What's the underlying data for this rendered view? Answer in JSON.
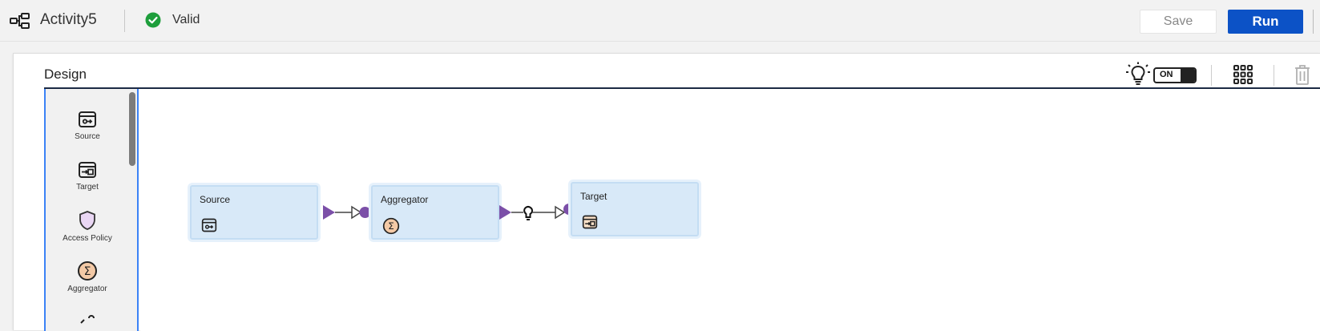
{
  "header": {
    "app_icon": "mapping-flow-icon",
    "title": "Activity5",
    "status_icon": "check-circle-icon",
    "status_text": "Valid",
    "status_color": "#1e9e3c",
    "save_label": "Save",
    "run_label": "Run",
    "run_color": "#0c52c6"
  },
  "design": {
    "title": "Design",
    "toggle_label": "ON",
    "toolbar_icons": [
      "lightbulb-icon",
      "grid-icon",
      "trash-icon"
    ]
  },
  "palette": {
    "items": [
      {
        "label": "Source",
        "icon": "source-icon"
      },
      {
        "label": "Target",
        "icon": "target-icon"
      },
      {
        "label": "Access Policy",
        "icon": "shield-icon"
      },
      {
        "label": "Aggregator",
        "icon": "sigma-icon"
      }
    ]
  },
  "canvas": {
    "nodes": [
      {
        "label": "Source",
        "icon": "source-icon"
      },
      {
        "label": "Aggregator",
        "icon": "sigma-icon"
      },
      {
        "label": "Target",
        "icon": "target-icon"
      }
    ],
    "accent_color": "#7b4fa8"
  }
}
